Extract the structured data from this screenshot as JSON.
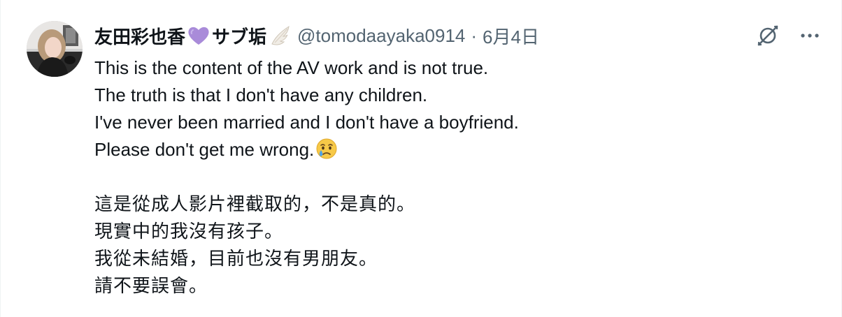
{
  "tweet": {
    "author": {
      "display_name_part1": "友田彩也香",
      "display_name_part2": "サブ垢",
      "name_icons": [
        "purple-heart-icon",
        "wing-icon"
      ],
      "handle": "@tomodaayaka0914",
      "separator": "·",
      "timestamp": "6月4日"
    },
    "actions": [
      "grok-icon",
      "more-icon"
    ],
    "text": {
      "en_line1": "This is the content of the AV work and is not true.",
      "en_line2": "The truth is that I don't have any children.",
      "en_line3": "I've never been married and I don't have a boyfriend.",
      "en_line4": "Please don't get me wrong.",
      "en_line4_emoji": "crying-face-icon",
      "zh_line1": "這是從成人影片裡截取的，不是真的。",
      "zh_line2": "現實中的我沒有孩子。",
      "zh_line3": "我從未結婚，目前也沒有男朋友。",
      "zh_line4": "請不要誤會。"
    },
    "colors": {
      "text_primary": "#0f1419",
      "text_secondary": "#536471",
      "heart": "#a98bd9"
    }
  }
}
